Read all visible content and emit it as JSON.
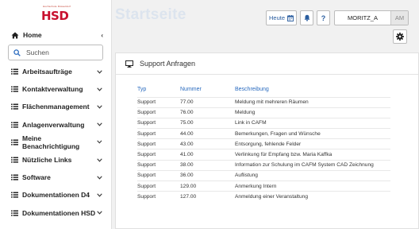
{
  "logo": {
    "tagline": "Hochschule Düsseldorf",
    "name": "HSD"
  },
  "sidebar": {
    "home_label": "Home",
    "search_placeholder": "Suchen",
    "items": [
      {
        "label": "Arbeitsaufträge"
      },
      {
        "label": "Kontaktverwaltung"
      },
      {
        "label": "Flächenmanagement"
      },
      {
        "label": "Anlagenverwaltung"
      },
      {
        "label": "Meine Benachrichtigung"
      },
      {
        "label": "Nützliche Links"
      },
      {
        "label": "Software"
      },
      {
        "label": "Dokumentationen D4"
      },
      {
        "label": "Dokumentationen HSD"
      }
    ]
  },
  "header": {
    "title": "Startseite",
    "today_label": "Heute",
    "help_label": "?",
    "user_name": "MORITZ_A",
    "user_initials": "AM"
  },
  "card": {
    "title": "Support Anfragen",
    "columns": [
      "Typ",
      "Nummer",
      "Beschreibung"
    ],
    "rows": [
      [
        "Support",
        "77.00",
        "Meldung mit mehreren Räumen"
      ],
      [
        "Support",
        "76.00",
        "Meldung"
      ],
      [
        "Support",
        "75.00",
        "Link in CAFM"
      ],
      [
        "Support",
        "44.00",
        "Bemerkungen, Fragen und Wünsche"
      ],
      [
        "Support",
        "43.00",
        "Entsorgung, fehlende Felder"
      ],
      [
        "Support",
        "41.00",
        "Verlinkung für Empfang bzw. Maria Kaffka"
      ],
      [
        "Support",
        "38.00",
        "Information zur Schulung im CAFM System CAD Zeichnung"
      ],
      [
        "Support",
        "36.00",
        "Auflistung"
      ],
      [
        "Support",
        "129.00",
        "Anmerkung Intern"
      ],
      [
        "Support",
        "127.00",
        "Anmeldung einer Veranstaltung"
      ]
    ]
  },
  "colors": {
    "accent": "#2a6bbf",
    "brand": "#c8102e",
    "title_faint": "#dce4ee"
  }
}
